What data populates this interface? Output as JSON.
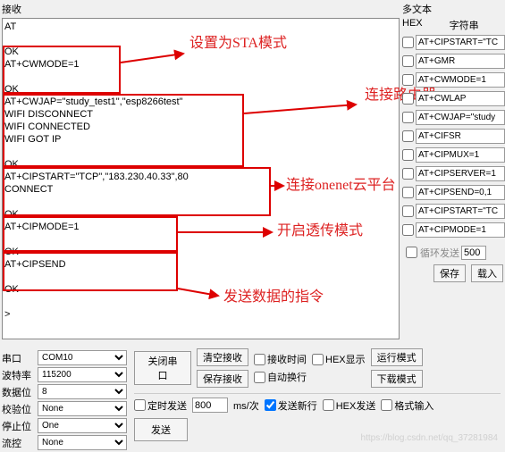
{
  "recv": {
    "title": "接收",
    "content": "AT\n\nOK\nAT+CWMODE=1\n\nOK\nAT+CWJAP=\"study_test1\",\"esp8266test\"\nWIFI DISCONNECT\nWIFI CONNECTED\nWIFI GOT IP\n\nOK\nAT+CIPSTART=\"TCP\",\"183.230.40.33\",80\nCONNECT\n\nOK\nAT+CIPMODE=1\n\nOK\nAT+CIPSEND\n\nOK\n\n>"
  },
  "annotations": {
    "a1": "设置为STA模式",
    "a2": "连接路由器",
    "a3": "连接onenet云平台",
    "a4": "开启透传模式",
    "a5": "发送数据的指令"
  },
  "multi": {
    "title": "多文本",
    "hex_label": "HEX",
    "str_label": "字符串",
    "rows": [
      {
        "chk": false,
        "text": "AT+CIPSTART=\"TC"
      },
      {
        "chk": false,
        "text": "AT+GMR"
      },
      {
        "chk": false,
        "text": "AT+CWMODE=1"
      },
      {
        "chk": false,
        "text": "AT+CWLAP"
      },
      {
        "chk": false,
        "text": "AT+CWJAP=\"study"
      },
      {
        "chk": false,
        "text": "AT+CIFSR"
      },
      {
        "chk": false,
        "text": "AT+CIPMUX=1"
      },
      {
        "chk": false,
        "text": "AT+CIPSERVER=1"
      },
      {
        "chk": false,
        "text": "AT+CIPSEND=0,1"
      },
      {
        "chk": false,
        "text": "AT+CIPSTART=\"TC"
      },
      {
        "chk": false,
        "text": "AT+CIPMODE=1"
      }
    ],
    "loop_label": "循环发送",
    "loop_value": "500",
    "save_btn": "保存",
    "load_btn": "载入"
  },
  "port": {
    "labels": {
      "port": "串口",
      "baud": "波特率",
      "databits": "数据位",
      "parity": "校验位",
      "stopbits": "停止位",
      "flow": "流控"
    },
    "values": {
      "port": "COM10",
      "baud": "115200",
      "databits": "8",
      "parity": "None",
      "stopbits": "One",
      "flow": "None"
    }
  },
  "toolbar": {
    "close_port": "关闭串口",
    "clear_recv": "清空接收",
    "save_recv": "保存接收",
    "recv_time": "接收时间",
    "hex_disp": "HEX显示",
    "autowrap": "自动换行",
    "run_mode": "运行模式",
    "download_mode": "下载模式",
    "timed_send": "定时发送",
    "timed_value": "800",
    "ms_unit": "ms/次",
    "send_newline": "发送新行",
    "hex_send": "HEX发送",
    "fmt_input": "格式输入",
    "send_btn": "发送"
  },
  "watermark": "https://blog.csdn.net/qq_37281984"
}
